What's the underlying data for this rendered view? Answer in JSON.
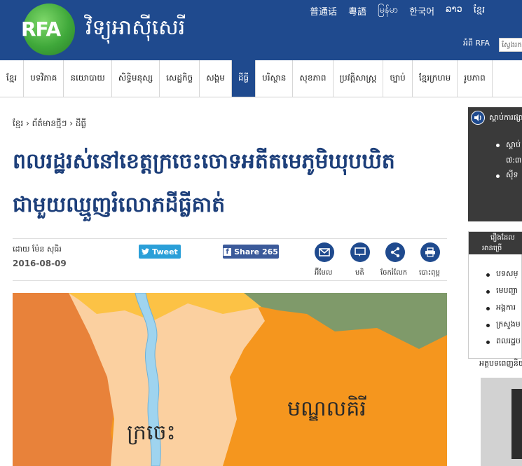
{
  "header": {
    "logo_text": "RFA",
    "site_name": "វិទ្យុអាស៊ីសេរី",
    "languages": [
      "普通话",
      "粵語",
      "မြန်မာ",
      "한국어",
      "ລາວ",
      "ខ្មែរ"
    ],
    "about": "អំពី RFA",
    "search_placeholder": "ស្វែងរក"
  },
  "nav": {
    "items": [
      "ខ្មែរ",
      "បទវិភាគ",
      "នយោបាយ",
      "សិទ្ធិមនុស្ស",
      "សេដ្ឋកិច្ច",
      "សង្គម",
      "ដីធ្លី",
      "បរិស្ថាន",
      "សុខភាព",
      "ប្រវត្តិសាស្ត្រ",
      "ច្បាប់",
      "ខ្មែរក្រហម",
      "រូបភាព"
    ],
    "active_index": 6
  },
  "article": {
    "breadcrumb": "ខ្មែរ › ព័ត៌មានថ្មីៗ › ដីធ្លី",
    "title": "ពលរដ្ឋរស់នៅខេត្តក្រចេះចោទអតីតមេភូមិឃុបឃិតជាមួយឈ្មួញរំលោភដីធ្លីគាត់",
    "byline": "ដោយ ម៉ែន សុធិរ",
    "date": "2016-08-09",
    "tweet_label": "Tweet",
    "share_label": "Share 265",
    "tools": [
      "អ៊ីមែល",
      "មតិ",
      "ចែករំលែក",
      "បោះពុម្ព"
    ],
    "map_labels": {
      "kratie": "ក្រចេះ",
      "mondulkiri": "មណ្ឌលគិរី"
    }
  },
  "sidebar": {
    "listen_title": "ស្ដាប់ការផ្សាយ",
    "listen_items": [
      "ស្ដាប់",
      "៧:៣",
      "ស៊ីទ"
    ],
    "related_header": [
      "រឿងដែល",
      "អានច្រើ"
    ],
    "related_items": [
      "បទសម្",
      "មេបញ្ជា",
      "អង្គការ",
      "ក្រសួងម",
      "ពលរដ្ឋប"
    ],
    "related_footer": "អត្ថបទពេញនិយម"
  },
  "colors": {
    "brand_blue": "#1f4a8e",
    "title_blue": "#1d3f7a",
    "twitter": "#2a9fd8",
    "facebook": "#3b5a9a"
  }
}
